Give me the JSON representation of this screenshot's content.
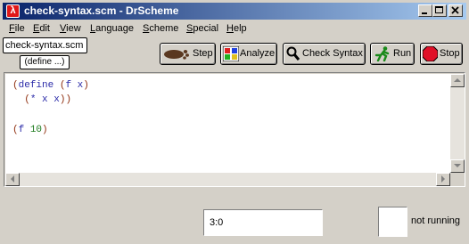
{
  "window": {
    "title": "check-syntax.scm - DrScheme",
    "app_icon_glyph": "λ"
  },
  "titlebar_buttons": {
    "minimize": "_",
    "maximize": "□",
    "close": "×"
  },
  "menu": [
    {
      "first": "F",
      "rest": "ile"
    },
    {
      "first": "E",
      "rest": "dit"
    },
    {
      "first": "V",
      "rest": "iew"
    },
    {
      "first": "L",
      "rest": "anguage"
    },
    {
      "first": "S",
      "rest": "cheme"
    },
    {
      "first": "S",
      "rest": "pecial"
    },
    {
      "first": "H",
      "rest": "elp"
    }
  ],
  "file_name": "check-syntax.scm",
  "definitions_popup": "(define ...)",
  "toolbar": {
    "step": {
      "label": "Step",
      "icon": "footprint-icon"
    },
    "analyze": {
      "label": "Analyze",
      "icon": "analyze-icon"
    },
    "check_syntax": {
      "label": "Check Syntax",
      "icon": "magnifier-icon"
    },
    "run": {
      "label": "Run",
      "icon": "running-man-icon"
    },
    "stop": {
      "label": "Stop",
      "icon": "stop-icon"
    }
  },
  "editor": {
    "code": {
      "line1": {
        "open": "(",
        "kw": "define",
        "sp1": " ",
        "open2": "(",
        "fn": "f",
        "sp2": " ",
        "arg": "x",
        "close": ")"
      },
      "line2": {
        "indent": "  ",
        "open": "(",
        "op": "*",
        "sp1": " ",
        "a": "x",
        "sp2": " ",
        "b": "x",
        "close": "))"
      },
      "line4": {
        "open": "(",
        "fn": "f",
        "sp": " ",
        "num": "10",
        "close": ")"
      }
    }
  },
  "status": {
    "position": "3:0",
    "state": "not running"
  },
  "colors": {
    "paren": "#903010",
    "identifier": "#2a2aa8",
    "number": "#1c7a1c",
    "titlebar_start": "#0a246a",
    "titlebar_end": "#a6caf0"
  }
}
